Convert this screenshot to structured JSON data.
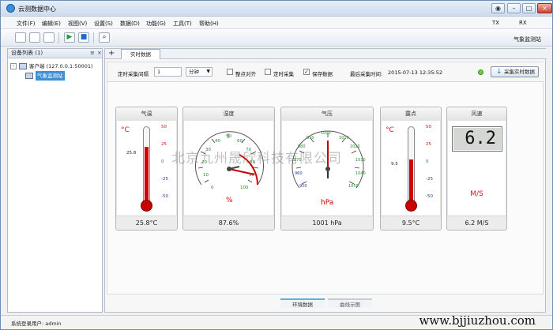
{
  "window": {
    "title": "云测数据中心",
    "buttons": [
      "◉",
      "–",
      "□",
      "×"
    ]
  },
  "menu": {
    "items": [
      "文件(F)",
      "编辑(E)",
      "视图(V)",
      "设置(S)",
      "数据(D)",
      "功能(G)",
      "工具(T)",
      "帮助(H)"
    ],
    "tx": "TX",
    "rx": "RX"
  },
  "toolbar": {
    "station": "气象监测站"
  },
  "sidebar": {
    "title": "设备列表 (1)",
    "pin": "≡",
    "close": "×",
    "client": "客户端 (127.0.0.1:50001)",
    "node": "气象监测站"
  },
  "main": {
    "plus": "+",
    "tab": "实时数据",
    "interval_label": "定时采集间隔",
    "interval_value": "1",
    "interval_unit": "分钟",
    "align": "整点对齐",
    "timed": "定时采集",
    "save": "保存数据",
    "last_label": "最后采集时间:",
    "last_time": "2015-07-13 12:35:52",
    "fetch": "采集实时数据"
  },
  "cards": {
    "temperature": {
      "title": "气温",
      "unit": "°C",
      "current": "25.8",
      "value": "25.8°C",
      "ticks": [
        "50",
        "25",
        "0",
        "-25",
        "-50"
      ]
    },
    "humidity": {
      "title": "湿度",
      "value": "87.6%",
      "unit": "%",
      "ticks": [
        "0",
        "10",
        "20",
        "30",
        "40",
        "50",
        "60",
        "70",
        "80",
        "90",
        "100"
      ]
    },
    "pressure": {
      "title": "气压",
      "value": "1001 hPa",
      "unit": "hPa",
      "ticks": [
        "950",
        "960",
        "970",
        "980",
        "990",
        "1000",
        "1010",
        "1020",
        "1030",
        "1040",
        "1050"
      ]
    },
    "dew": {
      "title": "露点",
      "unit": "°C",
      "current": "9.5",
      "value": "9.5°C",
      "ticks": [
        "50",
        "25",
        "0",
        "-25",
        "-50"
      ]
    },
    "wind": {
      "title": "风速",
      "lcd": "6.2",
      "unit": "M/S",
      "value": "6.2 M/S"
    }
  },
  "watermark": "北京九州晟欣科技有限公司",
  "bottom_tabs": [
    "环境数据",
    "曲线示图"
  ],
  "status": {
    "login": "系统登录用户: admin",
    "url": "www.bjjiuzhou.com"
  }
}
